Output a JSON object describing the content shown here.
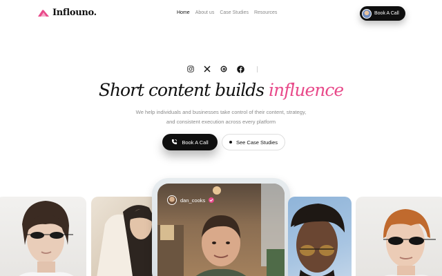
{
  "brand": {
    "name": "Inflouno."
  },
  "nav": {
    "links": [
      "Home",
      "About us",
      "Case Studies",
      "Resources"
    ],
    "active_index": 0,
    "cta_label": "Book A Call"
  },
  "social": {
    "icons": [
      "instagram-icon",
      "x-icon",
      "threads-icon",
      "facebook-icon"
    ]
  },
  "hero": {
    "headline_main": "Short content builds ",
    "headline_accent": "influence",
    "subtext_line1": "We help individuals and businesses take control of their content, strategy,",
    "subtext_line2": "and consistent execution across every platform",
    "primary_cta": "Book A Call",
    "secondary_cta": "See Case Studies"
  },
  "featured": {
    "handle": "dan_cooks"
  },
  "colors": {
    "accent": "#e84a8a",
    "dark": "#0f0f0f",
    "muted": "#8a8a8a"
  }
}
